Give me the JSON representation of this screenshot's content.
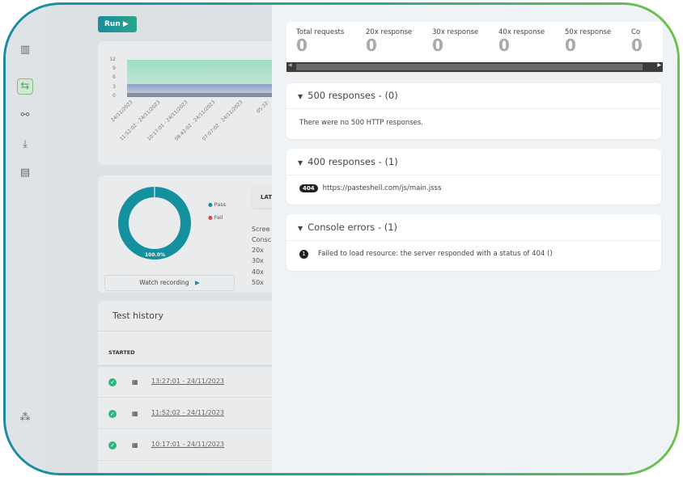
{
  "toolbar": {
    "run_label": "Run",
    "run_icon": "play-icon"
  },
  "sidebar": {
    "icons": [
      "chart-icon",
      "transfer-icon",
      "connection-icon",
      "download-icon",
      "report-icon",
      "settings-cluster-icon"
    ],
    "active_index": 1
  },
  "history_chart": {
    "type": "area",
    "y_ticks": [
      "12",
      "9",
      "6",
      "3",
      "0"
    ],
    "x_labels": [
      "24/11/2023",
      "11:52:02 - 24/11/2023",
      "10:17:01 - 24/11/2023",
      "08:42:02 - 24/11/2023",
      "07:07:02 - 24/11/2023",
      "05:32:"
    ],
    "colors": {
      "green": "#a3dcc4",
      "blue": "#8ea6c6",
      "grey": "#8a8fa0",
      "red": "#e05a4f"
    }
  },
  "result": {
    "percent_label": "100.0%",
    "pass_fraction": 1.0,
    "legend": [
      {
        "label": "Pass",
        "color": "#14909f"
      },
      {
        "label": "Fail",
        "color": "#e04040"
      }
    ],
    "tab_label": "LAT",
    "rows": [
      "Scree",
      "Consc",
      "20x",
      "30x",
      "40x",
      "50x"
    ],
    "watch_label": "Watch recording"
  },
  "test_history": {
    "title": "Test history",
    "column": "STARTED",
    "rows": [
      "13:27:01 - 24/11/2023",
      "11:52:02 - 24/11/2023",
      "10:17:01 - 24/11/2023"
    ]
  },
  "stats": [
    {
      "label": "Total requests",
      "value": "0"
    },
    {
      "label": "20x response",
      "value": "0"
    },
    {
      "label": "30x response",
      "value": "0"
    },
    {
      "label": "40x response",
      "value": "0"
    },
    {
      "label": "50x response",
      "value": "0"
    },
    {
      "label": "Co",
      "value": "0"
    }
  ],
  "sections": {
    "s500": {
      "title": "500 responses - (0)",
      "body": "There were no 500 HTTP responses."
    },
    "s400": {
      "title": "400 responses - (1)",
      "badge": "404",
      "url": "https://pasteshell.com/js/main.jsss"
    },
    "console": {
      "title": "Console errors - (1)",
      "index": "1",
      "message": "Failed to load resource: the server responded with a status of 404 ()"
    }
  },
  "frame_colors": {
    "start": "#1a8c9e",
    "end": "#6cc24a"
  }
}
